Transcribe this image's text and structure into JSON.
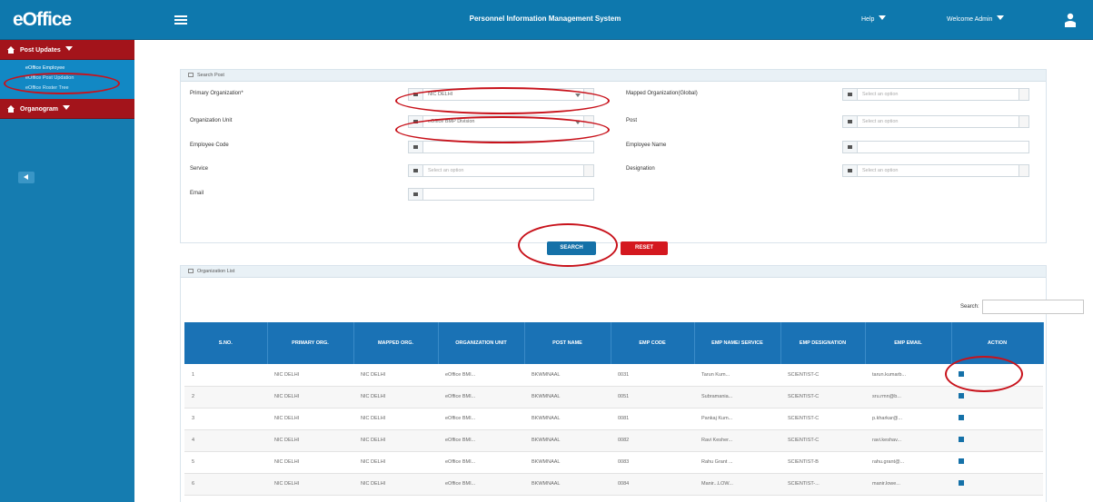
{
  "app": {
    "logo": "eOffice",
    "title": "Personnel Information Management System",
    "help_menu": "Help",
    "user_menu": "Welcome Admin",
    "accent": "#0e78ad",
    "sidebar_color": "#157cb0",
    "danger": "#d4181f"
  },
  "sidebar": {
    "group1": "Post Updates",
    "links": [
      "eOffice Employee",
      "eOffice Post Updation",
      "eOffice Roster Tree"
    ],
    "group2": "Organogram"
  },
  "search_panel": {
    "title": "Search Post",
    "fields": {
      "primary_org": {
        "label": "Primary Organization*",
        "value": "NIC DELHI"
      },
      "org_unit": {
        "label": "Organization Unit",
        "value": "eOffice BMP Division"
      },
      "employee_code": {
        "label": "Employee Code",
        "value": ""
      },
      "service": {
        "label": "Service",
        "placeholder": "Select an option"
      },
      "email": {
        "label": "Email",
        "value": ""
      },
      "mapped_org": {
        "label": "Mapped Organization(Global)",
        "placeholder": "Select an option"
      },
      "post": {
        "label": "Post",
        "placeholder": "Select an option"
      },
      "employee_name": {
        "label": "Employee Name",
        "value": ""
      },
      "designation": {
        "label": "Designation",
        "placeholder": "Select an option"
      }
    },
    "search_button": "SEARCH",
    "reset_button": "RESET"
  },
  "list_panel": {
    "title": "Organization List",
    "search_label": "Search:",
    "columns": [
      "S.NO.",
      "PRIMARY ORG.",
      "MAPPED ORG.",
      "ORGANIZATION UNIT",
      "POST NAME",
      "EMP CODE",
      "EMP NAME/ SERVICE",
      "EMP DESIGNATION",
      "EMP EMAIL",
      "ACTION"
    ],
    "rows": [
      [
        "1",
        "NIC DELHI",
        "NIC DELHI",
        "eOffice BMI...",
        "BKWMNAAL",
        "0031",
        "Tarun Kum...",
        "SCIENTIST-C",
        "tarun.kumarb..."
      ],
      [
        "2",
        "NIC DELHI",
        "NIC DELHI",
        "eOffice BMI...",
        "BKWMNAAL",
        "0051",
        "Subramania...",
        "SCIENTIST-C",
        "sru.rmn@b..."
      ],
      [
        "3",
        "NIC DELHI",
        "NIC DELHI",
        "eOffice BMI...",
        "BKWMNAAL",
        "0081",
        "Pankaj Kum...",
        "SCIENTIST-C",
        "p.kharkar@..."
      ],
      [
        "4",
        "NIC DELHI",
        "NIC DELHI",
        "eOffice BMI...",
        "BKWMNAAL",
        "0082",
        "Ravi Kesher...",
        "SCIENTIST-C",
        "ravi.keshav..."
      ],
      [
        "5",
        "NIC DELHI",
        "NIC DELHI",
        "eOffice BMI...",
        "BKWMNAAL",
        "0083",
        "Rahu Grant ...",
        "SCIENTIST-B",
        "rahu.grant@..."
      ],
      [
        "6",
        "NIC DELHI",
        "NIC DELHI",
        "eOffice BMI...",
        "BKWMNAAL",
        "0084",
        "Manir...LOW...",
        "SCIENTIST-...",
        "manir.lowe..."
      ]
    ]
  }
}
